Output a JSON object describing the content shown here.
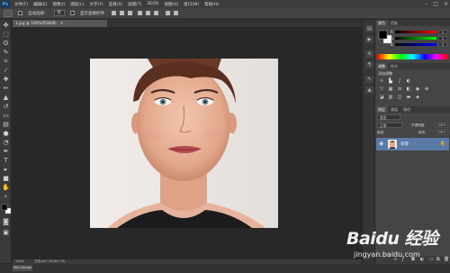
{
  "app": {
    "logo": "Ps",
    "menus": [
      "文件(F)",
      "编辑(E)",
      "图像(I)",
      "图层(L)",
      "文字(Y)",
      "选择(S)",
      "滤镜(T)",
      "3D(D)",
      "视图(V)",
      "窗口(W)",
      "帮助(H)"
    ],
    "window_controls": [
      "–",
      "□",
      "×"
    ]
  },
  "options_bar": {
    "auto_select_label": "自动选择：",
    "auto_select_target": "组",
    "show_transform_label": "显示变换控件"
  },
  "document": {
    "tab_title": "1.jpg @ 100%(RGB/8)",
    "close_symbol": "×"
  },
  "status": {
    "zoom": "100%",
    "doc_info": "文档:847.5K/847.5K"
  },
  "bottom": {
    "mini_bridge": "Mini Bridge"
  },
  "color_panel": {
    "tabs": [
      "颜色",
      "色板"
    ],
    "channels": [
      {
        "label": "R",
        "value": "0"
      },
      {
        "label": "G",
        "value": "0"
      },
      {
        "label": "B",
        "value": "0"
      }
    ]
  },
  "adjustments_panel": {
    "tabs": [
      "调整",
      "样式"
    ],
    "title": "添加调整"
  },
  "layers_panel": {
    "tabs": [
      "图层",
      "通道",
      "路径"
    ],
    "kind_label": "类型",
    "blend_mode": "正常",
    "opacity_label": "不透明度:",
    "opacity_value": "100%",
    "lock_label": "锁定:",
    "fill_label": "填充:",
    "fill_value": "100%",
    "layers": [
      {
        "name": "背景",
        "visible": true,
        "locked": true
      }
    ]
  },
  "watermark": {
    "logo_text": "Baidu 经验",
    "url": "jingyan.baidu.com"
  }
}
